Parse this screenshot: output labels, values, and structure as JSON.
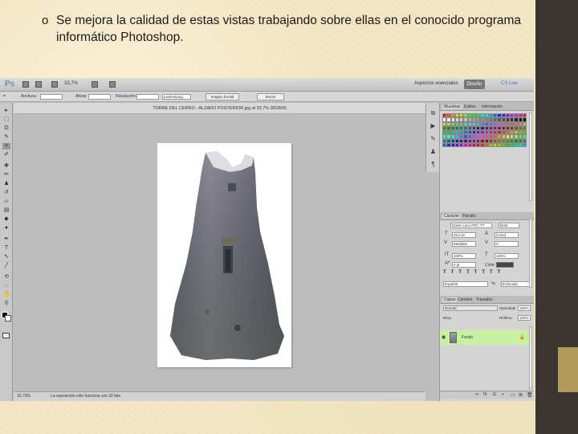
{
  "slide": {
    "bullet_marker": "o",
    "bullet_text": "Se mejora la calidad de estas vistas trabajando sobre ellas en el conocido programa informático Photoshop."
  },
  "photoshop": {
    "logo": "Ps",
    "zoom_level": "33,7%",
    "workspace": "Aspectos esenciales",
    "design_button": "Diseño",
    "cs_live": "CS Live",
    "options": {
      "width_label": "Anchura:",
      "height_label": "Altura:",
      "resolution_label": "Resolución:",
      "unit": "pixeles/pulg.",
      "front_image_button": "Imagen frontal",
      "clear_button": "Borrar"
    },
    "document_title": "TORRE DEL CERRO - ALZADO POSTERIOR.jpg al 33,7% (RGB/8)",
    "status": {
      "zoom": "33,73%",
      "message": "La exposición sólo funciona con 32 bits"
    },
    "panels": {
      "swatches_tabs": [
        "Muestras",
        "Estilos",
        "Información"
      ],
      "character_tabs": [
        "Carácter",
        "Párrafo"
      ],
      "layers_tabs": [
        "Capas",
        "Canales",
        "Trazados"
      ],
      "font_family": "Dante Lazo PRC TT",
      "font_style": "Bold",
      "font_size": "25,6 pt",
      "leading": "(Auto)",
      "kerning": "Medidas",
      "tracking": "0",
      "vertical_scale": "100%",
      "horizontal_scale": "100%",
      "baseline": "0 pt",
      "color_label": "Color:",
      "language": "Español",
      "antialias": "Enfocado",
      "blend_mode": "Normal",
      "opacity_label": "Opacidad:",
      "opacity": "100%",
      "lock_label": "Bloq.:",
      "fill_label": "Relleno:",
      "fill": "100%",
      "layer_name": "Fondo"
    },
    "text_color": "#3e4a3c"
  }
}
